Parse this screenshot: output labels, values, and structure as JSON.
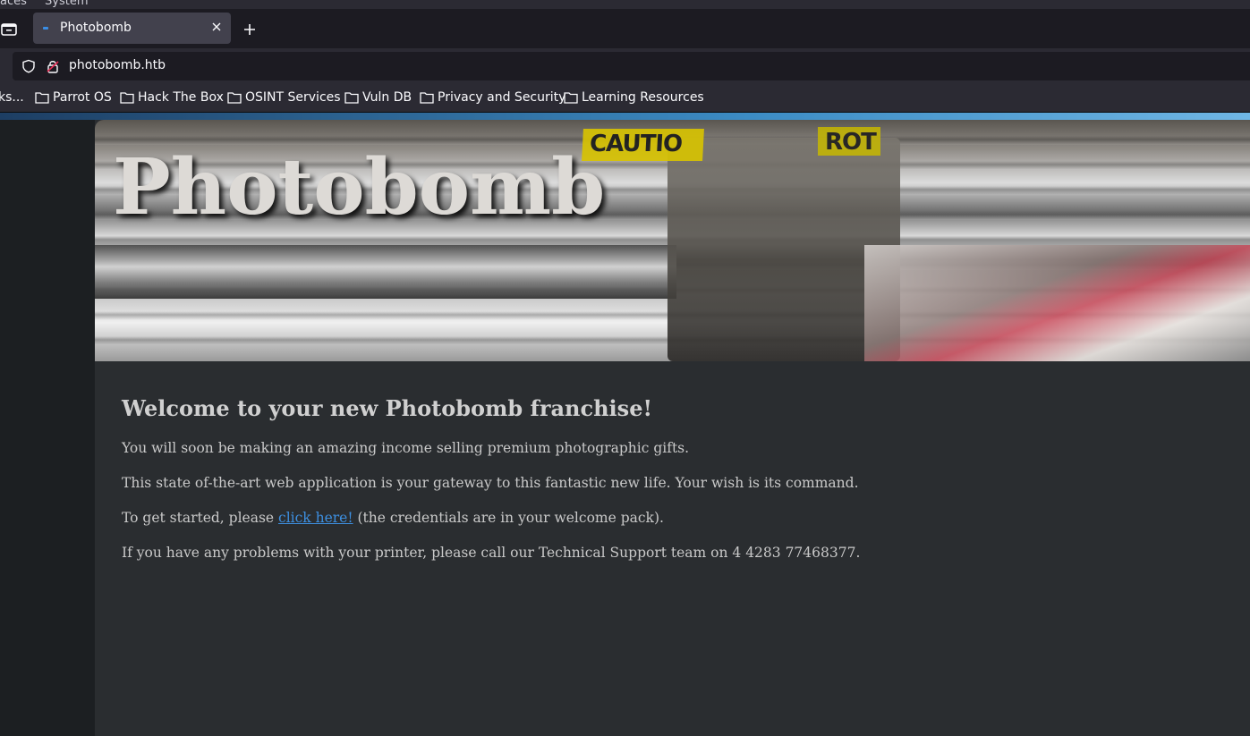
{
  "system_bar": {
    "left_text": "aces",
    "right_text": "System"
  },
  "browser": {
    "tab": {
      "title": "Photobomb"
    },
    "address": {
      "url": "photobomb.htb"
    },
    "bookmarks": [
      {
        "label": "ks..."
      },
      {
        "label": "Parrot OS"
      },
      {
        "label": "Hack The Box"
      },
      {
        "label": "OSINT Services"
      },
      {
        "label": "Vuln DB"
      },
      {
        "label": "Privacy and Security"
      },
      {
        "label": "Learning Resources"
      }
    ]
  },
  "page": {
    "hero_title": "Photobomb",
    "hero_sign_1": "CAUTIO",
    "hero_sign_2": "ROT",
    "heading": "Welcome to your new Photobomb franchise!",
    "para1": "You will soon be making an amazing income selling premium photographic gifts.",
    "para2": "This state of-the-art web application is your gateway to this fantastic new life. Your wish is its command.",
    "para3_before": "To get started, please ",
    "para3_link": "click here!",
    "para3_after": " (the credentials are in your welcome pack).",
    "para4": "If you have any problems with your printer, please call our Technical Support team on 4 4283 77468377."
  },
  "colors": {
    "chrome_dark": "#1c1b22",
    "chrome_toolbar": "#2b2a33",
    "tab_active": "#42414d",
    "page_bg": "#2a2d30",
    "link": "#3d8fe0"
  }
}
